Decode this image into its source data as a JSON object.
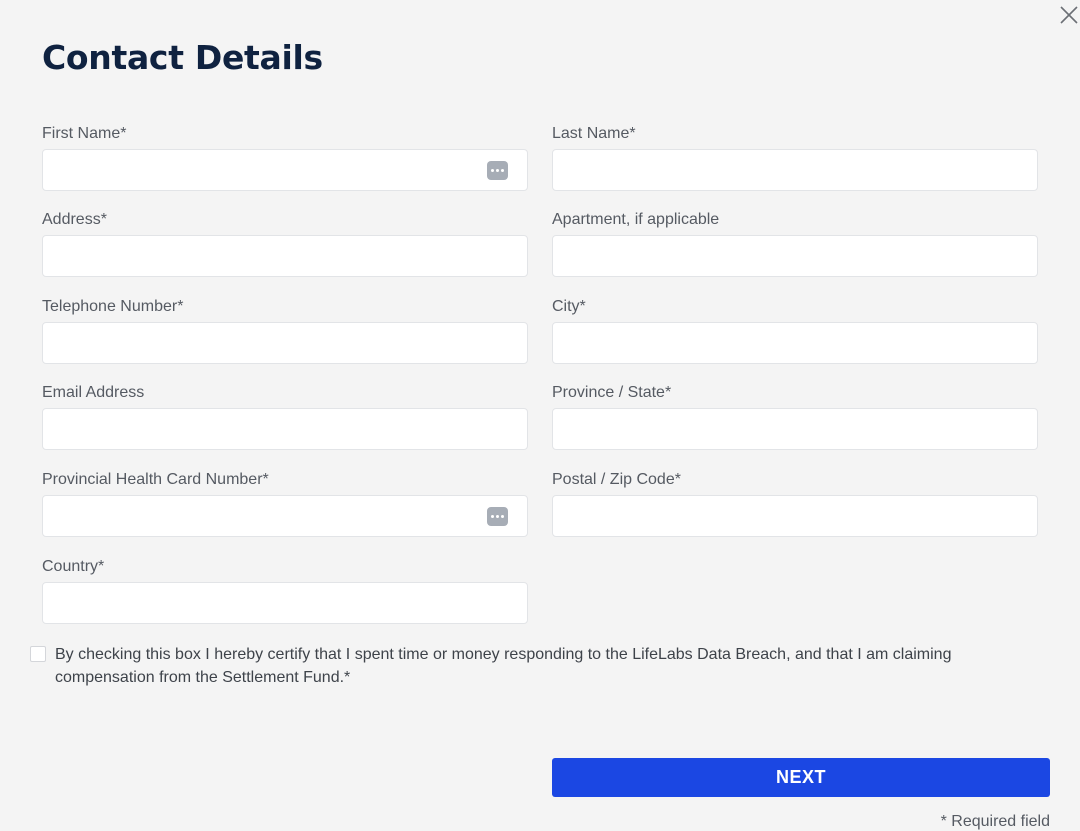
{
  "dialog": {
    "title": "Contact Details",
    "close_icon": "close-icon"
  },
  "fields": {
    "first_name": {
      "label": "First Name*",
      "value": "",
      "has_autofill_icon": true
    },
    "last_name": {
      "label": "Last Name*",
      "value": ""
    },
    "address": {
      "label": "Address*",
      "value": ""
    },
    "apartment": {
      "label": "Apartment, if applicable",
      "value": ""
    },
    "telephone": {
      "label": "Telephone Number*",
      "value": ""
    },
    "city": {
      "label": "City*",
      "value": ""
    },
    "email": {
      "label": "Email Address",
      "value": ""
    },
    "province": {
      "label": "Province / State*",
      "value": ""
    },
    "health_card": {
      "label": "Provincial Health Card Number*",
      "value": "",
      "has_autofill_icon": true
    },
    "postal": {
      "label": "Postal / Zip Code*",
      "value": ""
    },
    "country": {
      "label": "Country*",
      "value": ""
    }
  },
  "consent": {
    "checked": false,
    "text": "By checking this box I hereby certify that I spent time or money responding to the LifeLabs Data Breach, and that I am claiming compensation from the Settlement Fund.*"
  },
  "actions": {
    "next_label": "NEXT"
  },
  "footer": {
    "required_note": "* Required field"
  },
  "colors": {
    "background": "#f4f4f4",
    "title": "#0f2240",
    "primary_button": "#1b47e3",
    "input_border": "#e2e4e7"
  }
}
